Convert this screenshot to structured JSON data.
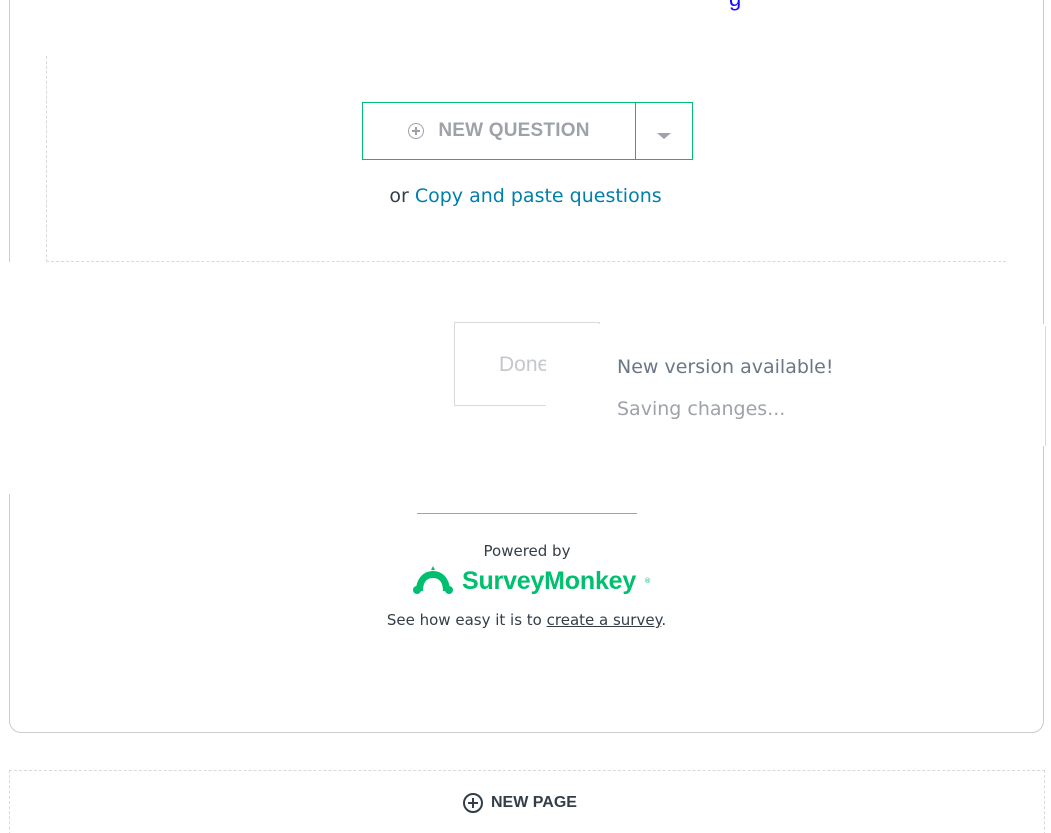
{
  "top_link": {
    "fragment": "g"
  },
  "question_area": {
    "new_question_label": "NEW QUESTION",
    "copy_prefix": "or",
    "copy_link": "Copy and paste questions"
  },
  "done_button": {
    "label": "Done"
  },
  "notifications": {
    "new_version": "New version available!",
    "saving": "Saving changes..."
  },
  "footer": {
    "powered_by": "Powered by",
    "brand": "SurveyMonkey",
    "tagline_prefix": "See how easy it is to",
    "tagline_link": "create a survey",
    "tagline_suffix": "."
  },
  "new_page": {
    "label": "NEW PAGE"
  },
  "colors": {
    "brand_green": "#00bf6f",
    "link_blue": "#007faa",
    "muted_gray": "#9ea3a9",
    "text_dark": "#333e48"
  },
  "icons": {
    "new_question": "plus-circle-icon",
    "dropdown": "caret-down-icon",
    "logo": "surveymonkey-logo-icon",
    "new_page": "plus-circle-icon"
  }
}
